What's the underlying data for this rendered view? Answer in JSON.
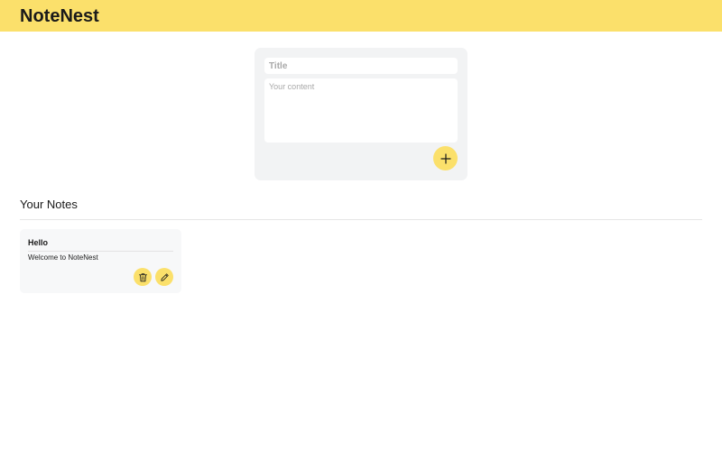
{
  "app": {
    "title": "NoteNest",
    "accent_color": "#fbe06b"
  },
  "composer": {
    "title_placeholder": "Title",
    "content_placeholder": "Your content",
    "add_icon": "plus-icon"
  },
  "notes_section": {
    "heading": "Your Notes"
  },
  "notes": [
    {
      "title": "Hello",
      "content": "Welcome to NoteNest",
      "actions": [
        "trash-icon",
        "pencil-icon"
      ]
    }
  ]
}
